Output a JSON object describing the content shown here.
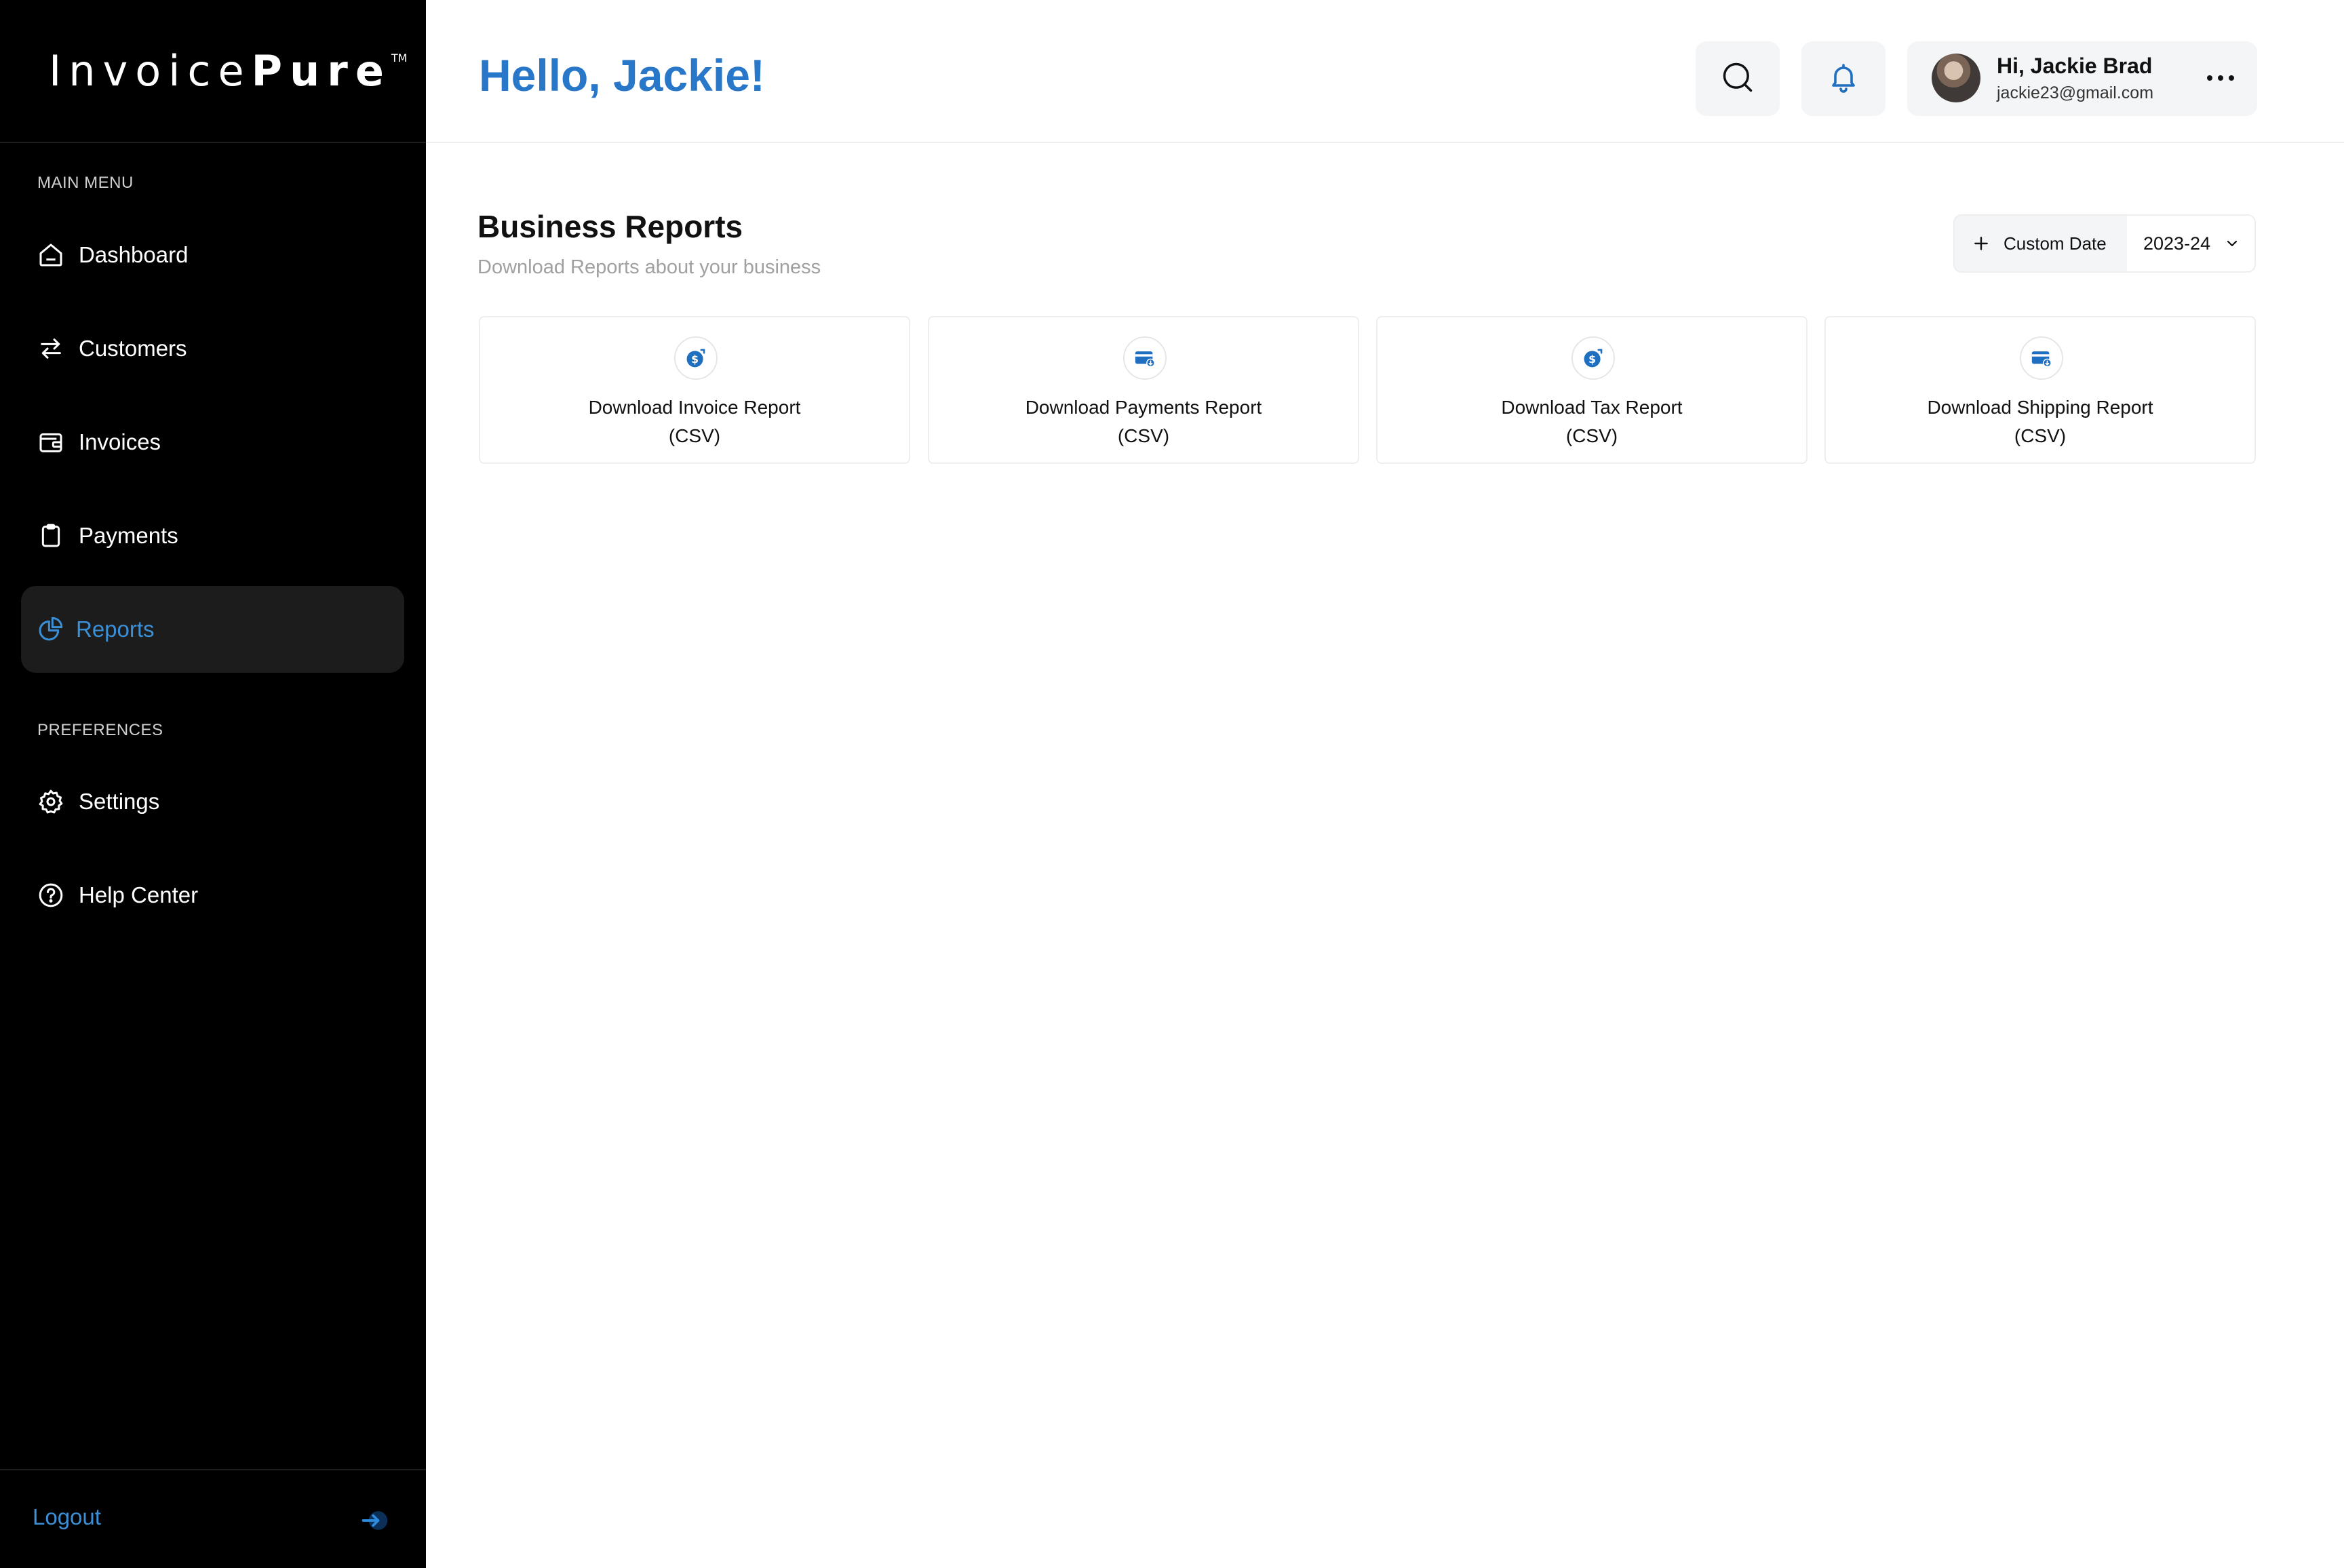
{
  "brand": {
    "name_light": "Invoice",
    "name_bold": "Pure",
    "trademark": "TM"
  },
  "sidebar": {
    "main_menu_label": "MAIN MENU",
    "items": [
      {
        "label": "Dashboard",
        "icon": "home-icon"
      },
      {
        "label": "Customers",
        "icon": "swap-arrows-icon"
      },
      {
        "label": "Invoices",
        "icon": "wallet-icon"
      },
      {
        "label": "Payments",
        "icon": "clipboard-icon"
      },
      {
        "label": "Reports",
        "icon": "pie-chart-icon",
        "active": true
      }
    ],
    "preferences_label": "PREFERENCES",
    "preferences": [
      {
        "label": "Settings",
        "icon": "gear-icon"
      },
      {
        "label": "Help Center",
        "icon": "help-circle-icon"
      }
    ],
    "logout_label": "Logout"
  },
  "header": {
    "greeting": "Hello, Jackie!",
    "user": {
      "name": "Hi, Jackie Brad",
      "email": "jackie23@gmail.com"
    }
  },
  "content": {
    "title": "Business Reports",
    "subtitle": "Download Reports about your business",
    "custom_date_label": "Custom Date",
    "year_value": "2023-24",
    "reports": [
      {
        "title": "Download Invoice Report",
        "format": "(CSV)",
        "icon": "dollar-coin-icon"
      },
      {
        "title": "Download Payments Report",
        "format": "(CSV)",
        "icon": "card-icon"
      },
      {
        "title": "Download Tax Report",
        "format": "(CSV)",
        "icon": "dollar-coin-icon"
      },
      {
        "title": "Download Shipping Report",
        "format": "(CSV)",
        "icon": "card-icon"
      }
    ]
  },
  "colors": {
    "accent": "#2877c9",
    "sidebar_bg": "#000000",
    "active_item_bg": "#1c1c1c",
    "muted_text": "#a0a0a0"
  }
}
